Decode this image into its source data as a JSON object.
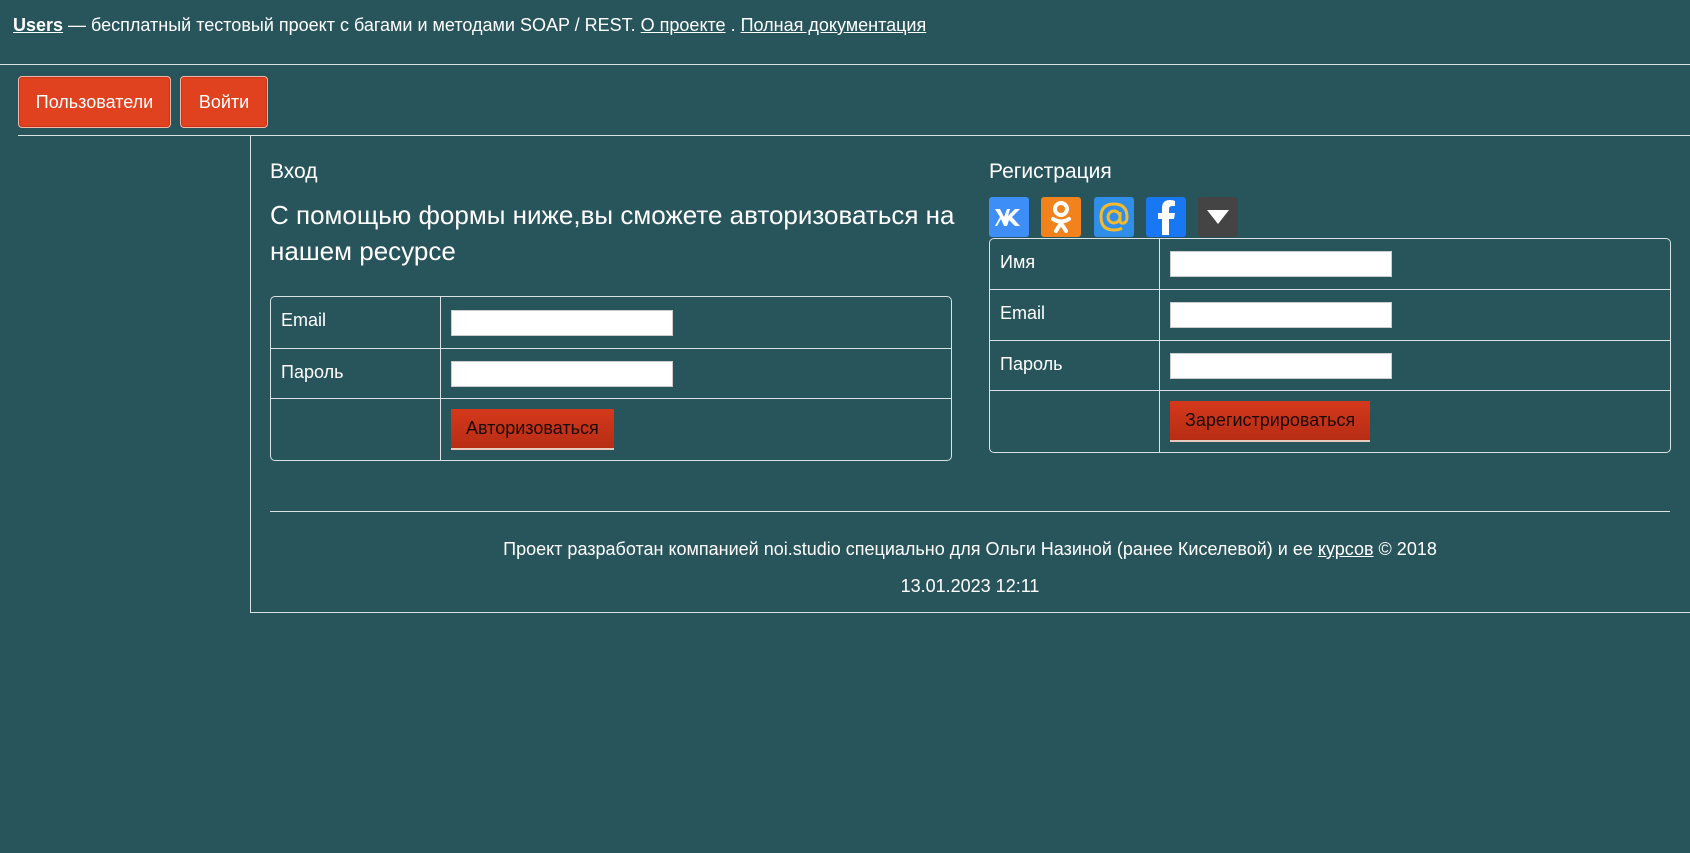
{
  "header": {
    "brand_link": "Users",
    "description": " — бесплатный тестовый проект с багами и методами SOAP / REST. ",
    "about_link": "О проекте",
    "separator": " . ",
    "docs_link": "Полная документация"
  },
  "nav": {
    "users_button": "Пользователи",
    "login_button": "Войти"
  },
  "login": {
    "title": "Вход",
    "lead": "С помощью формы ниже,вы сможете авторизоваться на нашем ресурсе",
    "email_label": "Email",
    "email_value": "",
    "password_label": "Пароль",
    "password_value": "",
    "submit": "Авторизоваться"
  },
  "register": {
    "title": "Регистрация",
    "social_icons": [
      "vk-icon",
      "odnoklassniki-icon",
      "mailru-icon",
      "facebook-icon",
      "more-dropdown-icon"
    ],
    "name_label": "Имя",
    "name_value": "",
    "email_label": "Email",
    "email_value": "",
    "password_label": "Пароль",
    "password_value": "",
    "submit": "Зарегистрироваться"
  },
  "footer": {
    "text_before": "Проект разработан компанией noi.studio специально для Ольги Назиной (ранее Киселевой) и ее ",
    "courses_link": "курсов",
    "text_after": " © 2018",
    "datetime": "13.01.2023 12:11"
  },
  "colors": {
    "background": "#28545b",
    "button_red": "#e0421f",
    "vk": "#3e8ef7",
    "ok": "#f2821b",
    "mailru": "#2f8fe8",
    "facebook": "#1877f2",
    "more": "#444444"
  }
}
